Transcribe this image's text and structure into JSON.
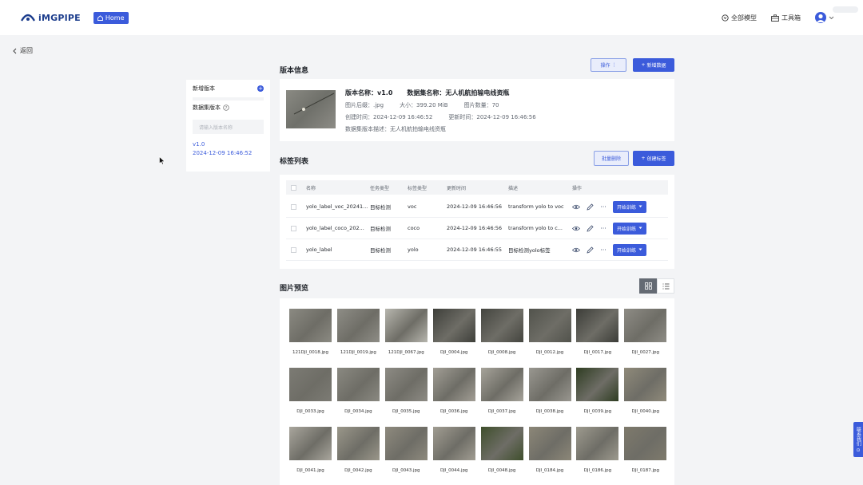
{
  "topbar": {
    "logo_text": "iMGPIPE",
    "home_label": "Home",
    "all_models_label": "全部模型",
    "toolbox_label": "工具箱"
  },
  "back_label": "返回",
  "sidebar": {
    "new_version_label": "新增版本",
    "dataset_version_label": "数据集版本",
    "search_placeholder": "请输入版本名称",
    "versions": [
      {
        "name": "v1.0",
        "time": "2024-12-09 16:46:52"
      }
    ]
  },
  "version_info": {
    "section_title": "版本信息",
    "ops_label": "操作",
    "new_data_label": "新增数据",
    "version_name": "版本名称：v1.0",
    "dataset_name": "数据集名称：无人机航拍输电线资瓶",
    "suffix": "图片后缀：.jpg",
    "size": "大小：399.20 MiB",
    "count": "图片数量：70",
    "created": "创建时间：2024-12-09 16:46:52",
    "updated": "更新时间：2024-12-09 16:46:56",
    "desc": "数据集版本描述：无人机航拍输电线资瓶"
  },
  "labels": {
    "section_title": "标签列表",
    "batch_delete_label": "批量删除",
    "create_label": "创建标签",
    "columns": [
      "名称",
      "任务类型",
      "标签类型",
      "更新时间",
      "描述",
      "操作"
    ],
    "train_label": "开始训练",
    "rows": [
      {
        "name": "yolo_label_voc_20241...",
        "task": "目标检测",
        "type": "voc",
        "time": "2024-12-09 16:46:56",
        "desc": "transform yolo to voc"
      },
      {
        "name": "yolo_label_coco_202...",
        "task": "目标检测",
        "type": "coco",
        "time": "2024-12-09 16:46:56",
        "desc": "transform yolo to c..."
      },
      {
        "name": "yolo_label",
        "task": "目标检测",
        "type": "yolo",
        "time": "2024-12-09 16:46:55",
        "desc": "目标检测yolo标签"
      }
    ]
  },
  "preview": {
    "section_title": "图片预览",
    "images": [
      {
        "name": "121DJI_0018.jpg",
        "color": "#8b8a82"
      },
      {
        "name": "121DJI_0019.jpg",
        "color": "#8e8d86"
      },
      {
        "name": "121DJI_0067.jpg",
        "color": "#b7b6ae"
      },
      {
        "name": "DJI_0004.jpg",
        "color": "#3e3f3a"
      },
      {
        "name": "DJI_0008.jpg",
        "color": "#44453f"
      },
      {
        "name": "DJI_0012.jpg",
        "color": "#52534c"
      },
      {
        "name": "DJI_0017.jpg",
        "color": "#3c3d38"
      },
      {
        "name": "DJI_0027.jpg",
        "color": "#8e8c85"
      },
      {
        "name": "DJI_0033.jpg",
        "color": "#7c7b74"
      },
      {
        "name": "DJI_0034.jpg",
        "color": "#8a8981"
      },
      {
        "name": "DJI_0035.jpg",
        "color": "#8d8b84"
      },
      {
        "name": "DJI_0036.jpg",
        "color": "#a29e95"
      },
      {
        "name": "DJI_0037.jpg",
        "color": "#a6a39a"
      },
      {
        "name": "DJI_0038.jpg",
        "color": "#999790"
      },
      {
        "name": "DJI_0039.jpg",
        "color": "#2f3d22"
      },
      {
        "name": "DJI_0040.jpg",
        "color": "#8f8a7a"
      },
      {
        "name": "DJI_0041.jpg",
        "color": "#a9a69d"
      },
      {
        "name": "DJI_0042.jpg",
        "color": "#9a978a"
      },
      {
        "name": "DJI_0043.jpg",
        "color": "#8e8a7e"
      },
      {
        "name": "DJI_0044.jpg",
        "color": "#a19d92"
      },
      {
        "name": "DJI_0048.jpg",
        "color": "#3f4f2c"
      },
      {
        "name": "DJI_0184.jpg",
        "color": "#8c8778"
      },
      {
        "name": "DJI_0186.jpg",
        "color": "#9d9a8e"
      },
      {
        "name": "DJI_0187.jpg",
        "color": "#7e7a6c"
      }
    ]
  },
  "float_help": "联系我们",
  "colors": {
    "primary": "#3b5bdb",
    "bg": "#f3f4f6"
  }
}
